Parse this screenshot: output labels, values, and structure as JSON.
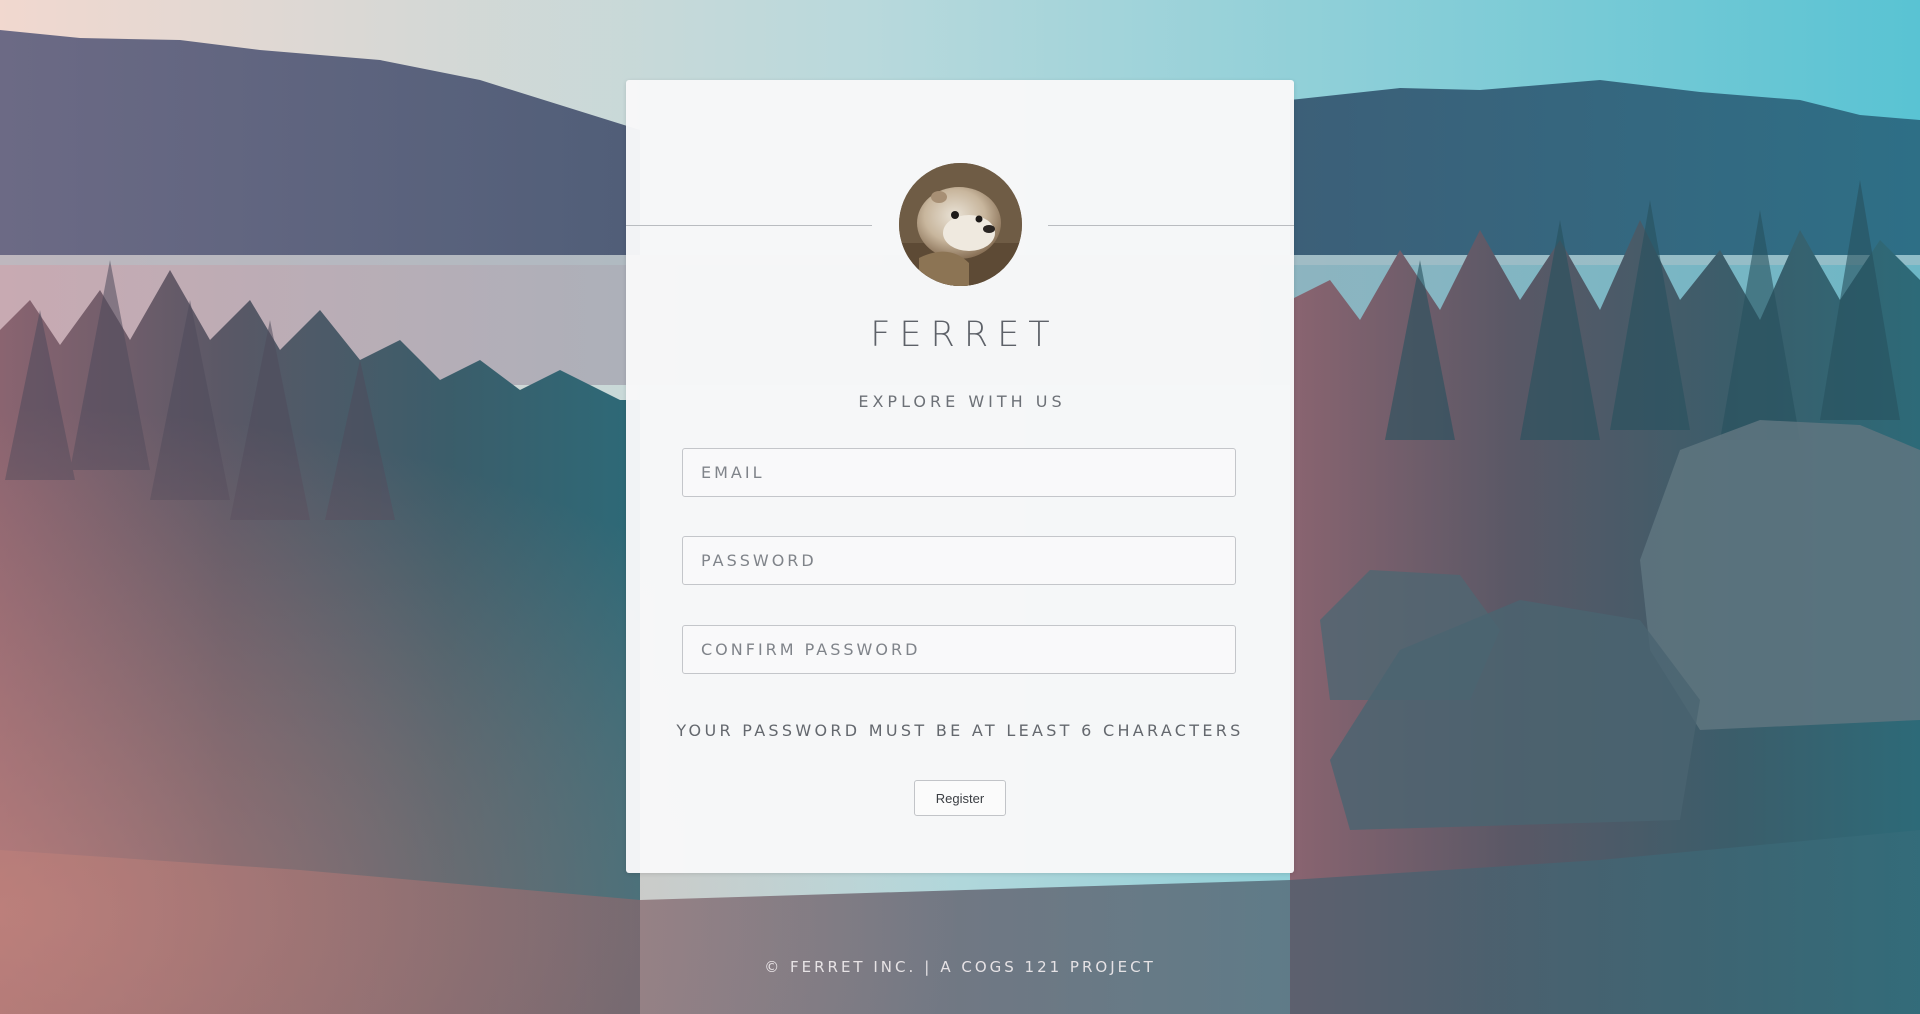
{
  "brand": {
    "name": "FERRET",
    "tagline": "EXPLORE WITH US"
  },
  "form": {
    "email_placeholder": "EMAIL",
    "password_placeholder": "PASSWORD",
    "confirm_placeholder": "CONFIRM PASSWORD",
    "hint": "YOUR PASSWORD MUST BE AT LEAST 6 CHARACTERS",
    "register_label": "Register"
  },
  "footer": {
    "left": "© FERRET INC.",
    "separator": "|",
    "right": "A COGS 121 PROJECT"
  },
  "colors": {
    "sky_left": "#f3d6cf",
    "sky_right": "#5fc6d6",
    "card_bg": "#f8f8f9",
    "text": "#5d6168"
  },
  "icons": {
    "avatar": "ferret-avatar-image"
  }
}
